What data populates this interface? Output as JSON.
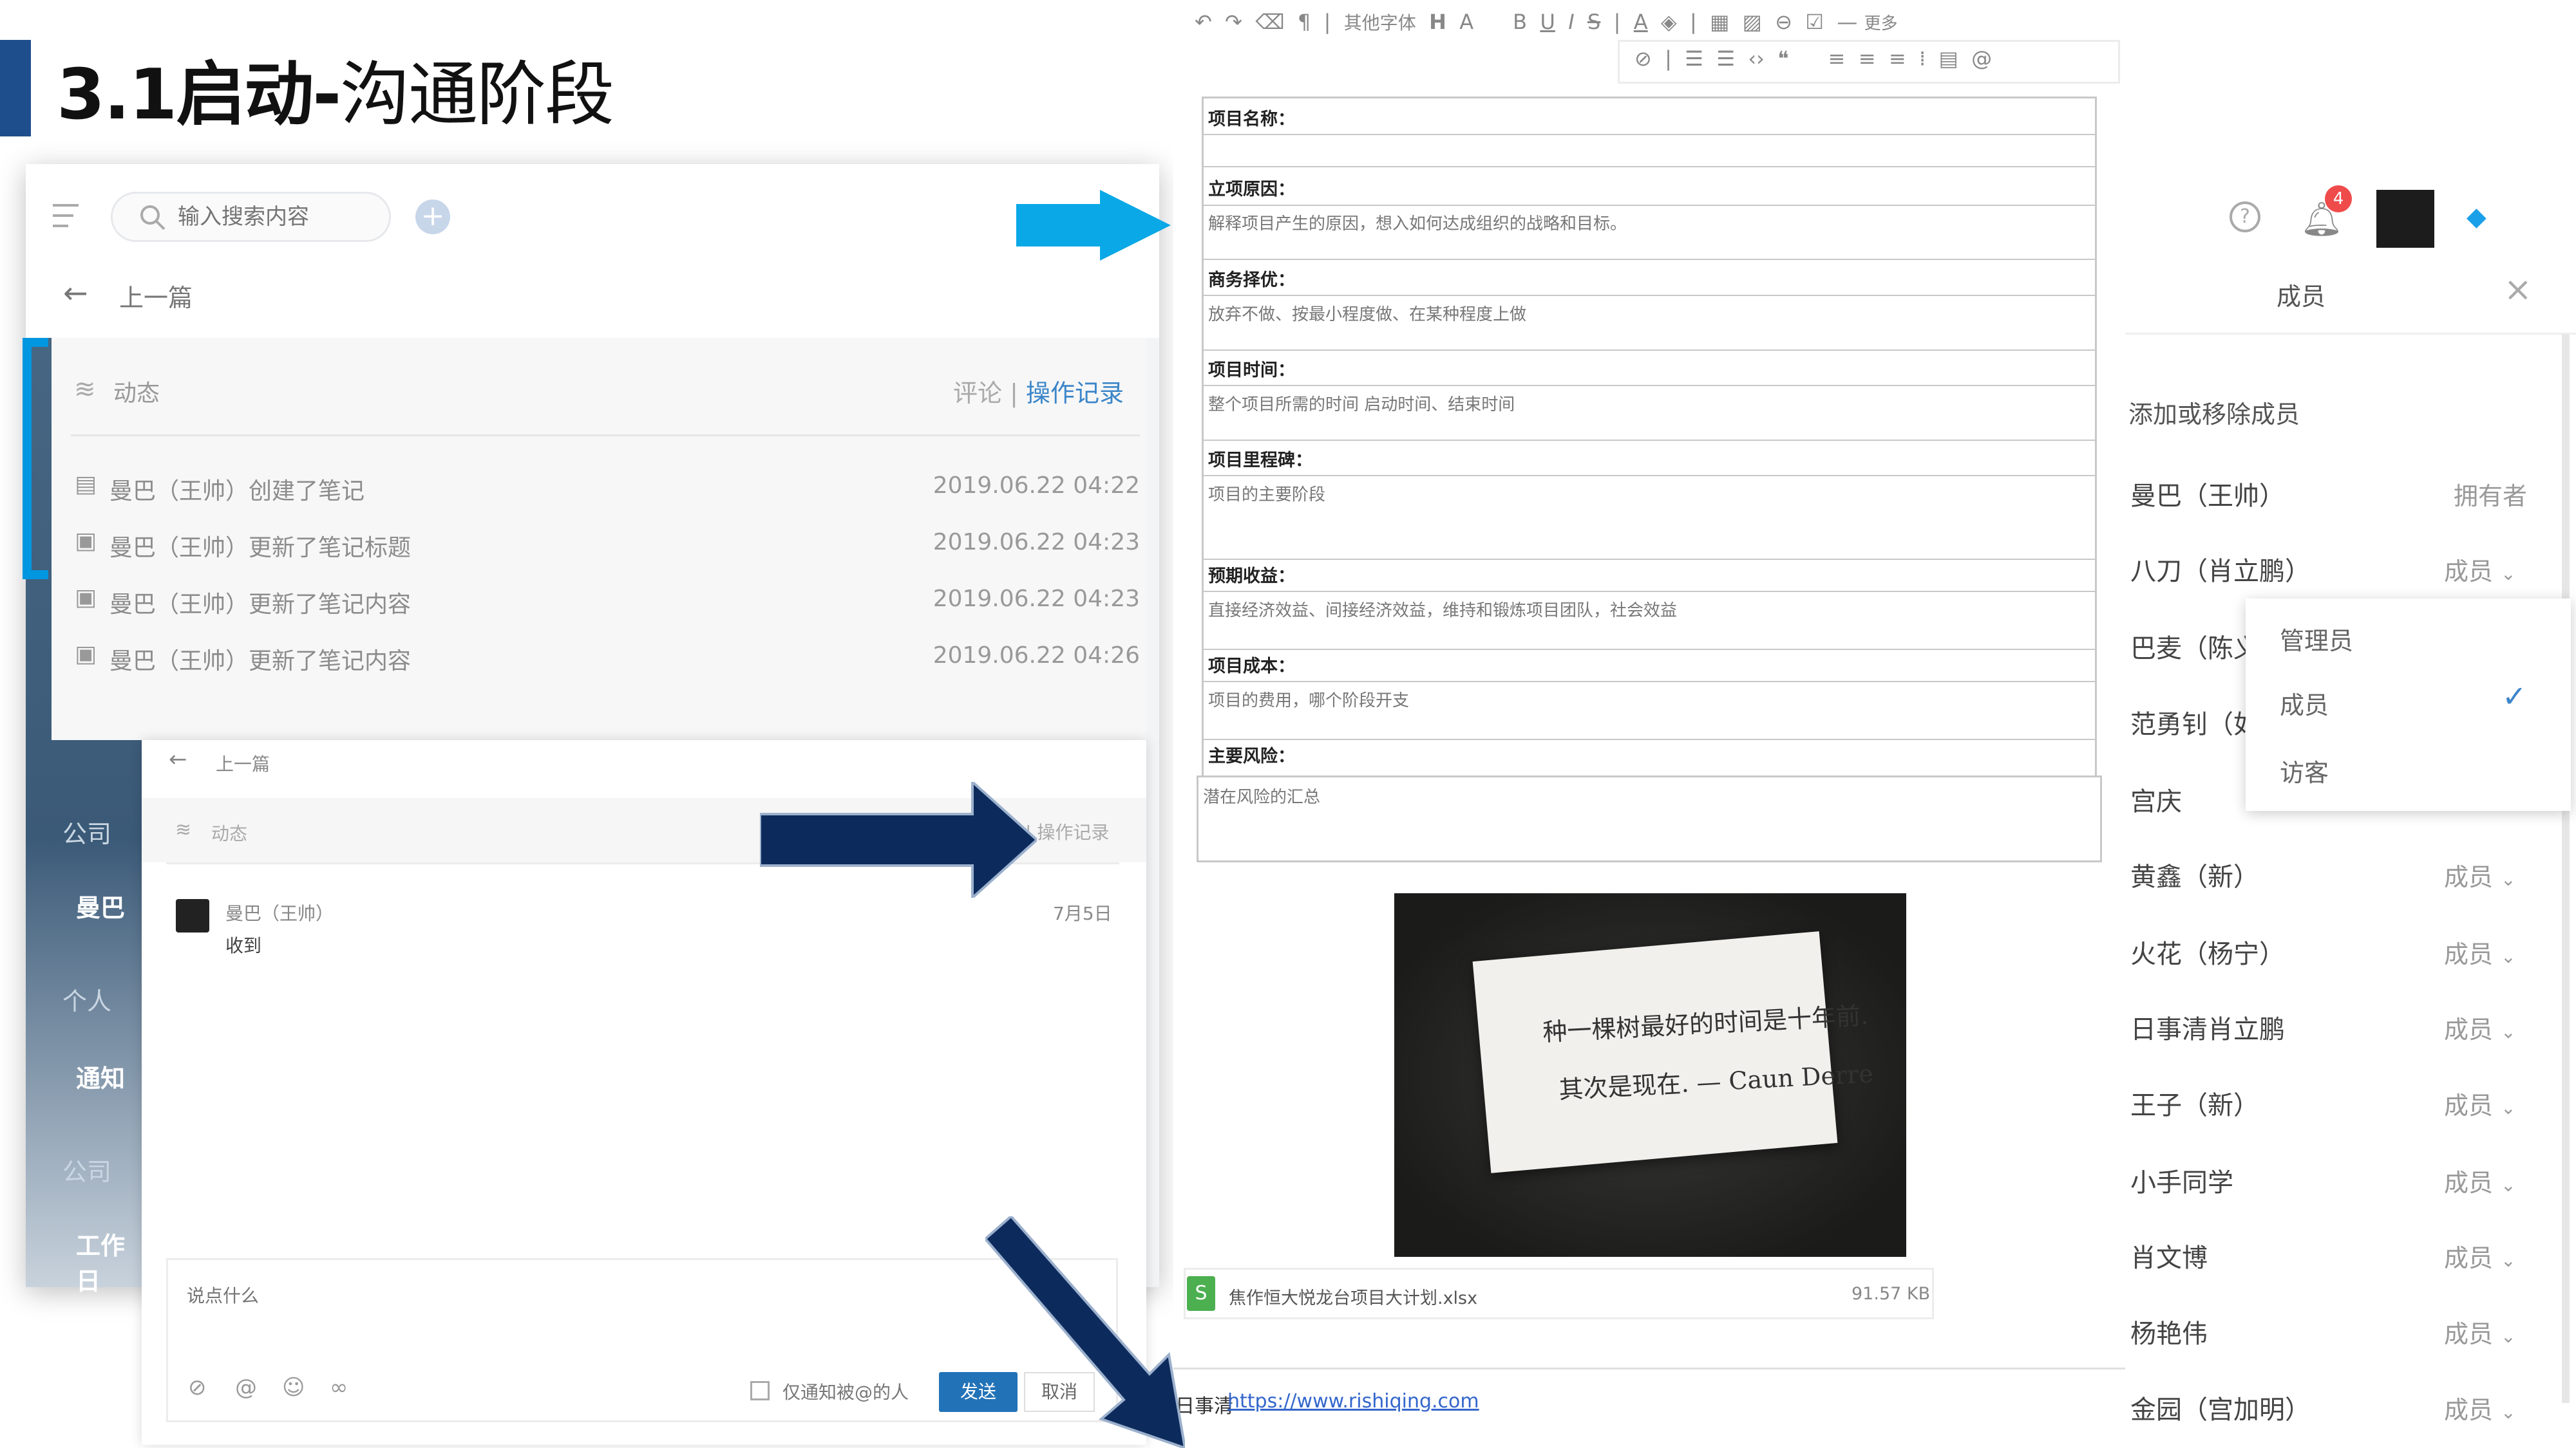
{
  "slide": {
    "title_bold": "3.1启动-",
    "title_rest": "沟通阶段"
  },
  "app": {
    "search_placeholder": "输入搜索内容",
    "back_label": "上一篇",
    "sidebar": [
      {
        "label": "公司",
        "kind": "section"
      },
      {
        "label": "曼巴",
        "kind": "item"
      },
      {
        "label": "个人",
        "kind": "section"
      },
      {
        "label": "通知",
        "kind": "item"
      },
      {
        "label": "公司",
        "kind": "section"
      },
      {
        "label": "工作日",
        "kind": "item"
      }
    ],
    "activity": {
      "title": "动态",
      "tab_comment": "评论",
      "tab_separator": "|",
      "tab_log": "操作记录",
      "logs": [
        {
          "text": "曼巴（王帅）创建了笔记",
          "time": "2019.06.22 04:22"
        },
        {
          "text": "曼巴（王帅）更新了笔记标题",
          "time": "2019.06.22 04:23"
        },
        {
          "text": "曼巴（王帅）更新了笔记内容",
          "time": "2019.06.22 04:23"
        },
        {
          "text": "曼巴（王帅）更新了笔记内容",
          "time": "2019.06.22 04:26"
        }
      ]
    },
    "comment_window": {
      "back_label": "上一篇",
      "activity_title": "动态",
      "tab_log": "| 操作记录",
      "comment": {
        "author": "曼巴（王帅）",
        "text": "收到",
        "date": "7月5日"
      },
      "input_placeholder": "说点什么",
      "notify_label": "仅通知被@的人",
      "send_label": "发送",
      "cancel_label": "取消"
    }
  },
  "editor": {
    "toolbar_font": "其他字体",
    "toolbar_more": "更多",
    "fields": [
      {
        "label": "项目名称：",
        "hint": ""
      },
      {
        "label": "立项原因：",
        "hint": "解释项目产生的原因，想入如何达成组织的战略和目标。"
      },
      {
        "label": "商务择优：",
        "hint": "放弃不做、按最小程度做、在某种程度上做"
      },
      {
        "label": "项目时间：",
        "hint": "整个项目所需的时间 启动时间、结束时间"
      },
      {
        "label": "项目里程碑：",
        "hint": "项目的主要阶段"
      },
      {
        "label": "预期收益：",
        "hint": "直接经济效益、间接经济效益，维持和锻炼项目团队，社会效益"
      },
      {
        "label": "项目成本：",
        "hint": "项目的费用，哪个阶段开支"
      },
      {
        "label": "主要风险：",
        "hint": "潜在风险的汇总"
      }
    ],
    "photo_card": {
      "line1": "种一棵树最好的时间是十年前.",
      "line2": "其次是现在. — Caun Derre"
    },
    "attachment": {
      "name": "焦作恒大悦龙台项目大计划.xlsx",
      "size": "91.57 KB"
    },
    "footer": {
      "label": "日事清",
      "link": "https://www.rishiqing.com"
    }
  },
  "members": {
    "title": "成员",
    "notification_count": "4",
    "add_remove": "添加或移除成员",
    "list": [
      {
        "name": "曼巴（王帅）",
        "role": "拥有者"
      },
      {
        "name": "八刀（肖立鹏）",
        "role": "成员"
      },
      {
        "name": "巴麦（陈义",
        "role": ""
      },
      {
        "name": "范勇钊（如",
        "role": ""
      },
      {
        "name": "宫庆",
        "role": ""
      },
      {
        "name": "黄鑫（新）",
        "role": "成员"
      },
      {
        "name": "火花（杨宁）",
        "role": "成员"
      },
      {
        "name": "日事清肖立鹏",
        "role": "成员"
      },
      {
        "name": "王子（新）",
        "role": "成员"
      },
      {
        "name": "小手同学",
        "role": "成员"
      },
      {
        "name": "肖文博",
        "role": "成员"
      },
      {
        "name": "杨艳伟",
        "role": "成员"
      },
      {
        "name": "金园（宫加明）",
        "role": "成员"
      }
    ],
    "role_options": [
      "管理员",
      "成员",
      "访客"
    ],
    "selected_role": "成员"
  },
  "colors": {
    "accent_blue": "#0096e0",
    "arrow_navy": "#0d2a5c",
    "primary": "#2272b8",
    "badge_red": "#f04b4b"
  }
}
